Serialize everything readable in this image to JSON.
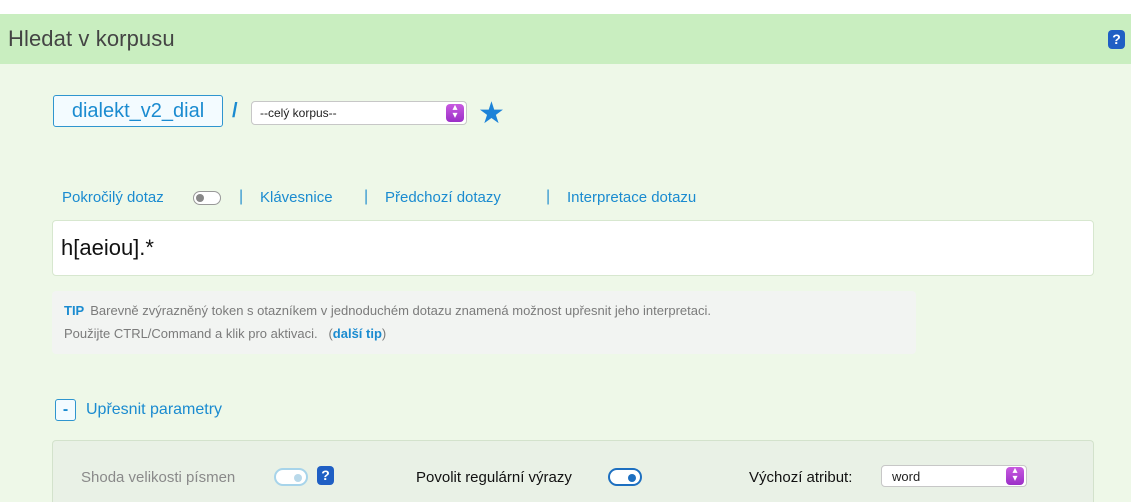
{
  "header": {
    "title": "Hledat v korpusu",
    "help": "?"
  },
  "corpus": {
    "name": "dialekt_v2_dial",
    "separator": "/",
    "subcorpus_selected": "--celý korpus--",
    "favorite_icon": "star-icon"
  },
  "query_links": [
    {
      "label": "Pokročilý dotaz"
    },
    {
      "label": "Klávesnice"
    },
    {
      "label": "Předchozí dotazy"
    },
    {
      "label": "Interpretace dotazu"
    }
  ],
  "query": {
    "value": "h[aeiou].*"
  },
  "tip": {
    "label": "TIP",
    "line1": "Barevně zvýrazněný token s otazníkem v jednoduchém dotazu znamená možnost upřesnit jeho interpretaci.",
    "line2": "Použijte CTRL/Command a klik pro aktivaci.",
    "link": "další tip",
    "open_paren": "(",
    "close_paren": ")"
  },
  "params": {
    "toggle_symbol": "-",
    "label": "Upřesnit parametry",
    "case_sensitivity": {
      "label": "Shoda velikosti písmen",
      "enabled": false,
      "help": "?"
    },
    "regex": {
      "label": "Povolit regulární výrazy",
      "enabled": true
    },
    "default_attr": {
      "label": "Výchozí atribut:",
      "value": "word"
    }
  },
  "colors": {
    "accent": "#1a8bd0",
    "header_bg": "#c9eec0",
    "panel_bg": "#eef8e8",
    "select_arrow": "#b040d8"
  }
}
